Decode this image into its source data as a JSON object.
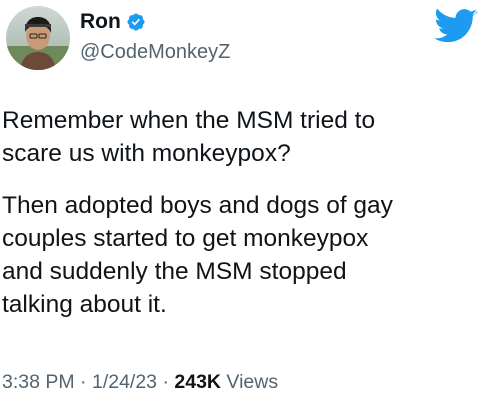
{
  "tweet": {
    "author": {
      "display_name": "Ron",
      "handle": "@CodeMonkeyZ",
      "verified": true
    },
    "paragraphs": [
      "Remember when the MSM tried to\nscare us with monkeypox?",
      "Then adopted boys and dogs of gay\ncouples started to get monkeypox\nand suddenly the MSM stopped\ntalking about it."
    ],
    "meta": {
      "time": "3:38 PM",
      "date": "1/24/23",
      "separator": "·",
      "views_count": "243K",
      "views_label": "Views"
    }
  },
  "icons": {
    "verified": "verified-badge-icon",
    "brand": "twitter-bird-icon"
  },
  "colors": {
    "brand_blue": "#1d9bf0",
    "text_primary": "#0f1419",
    "text_secondary": "#536471"
  }
}
